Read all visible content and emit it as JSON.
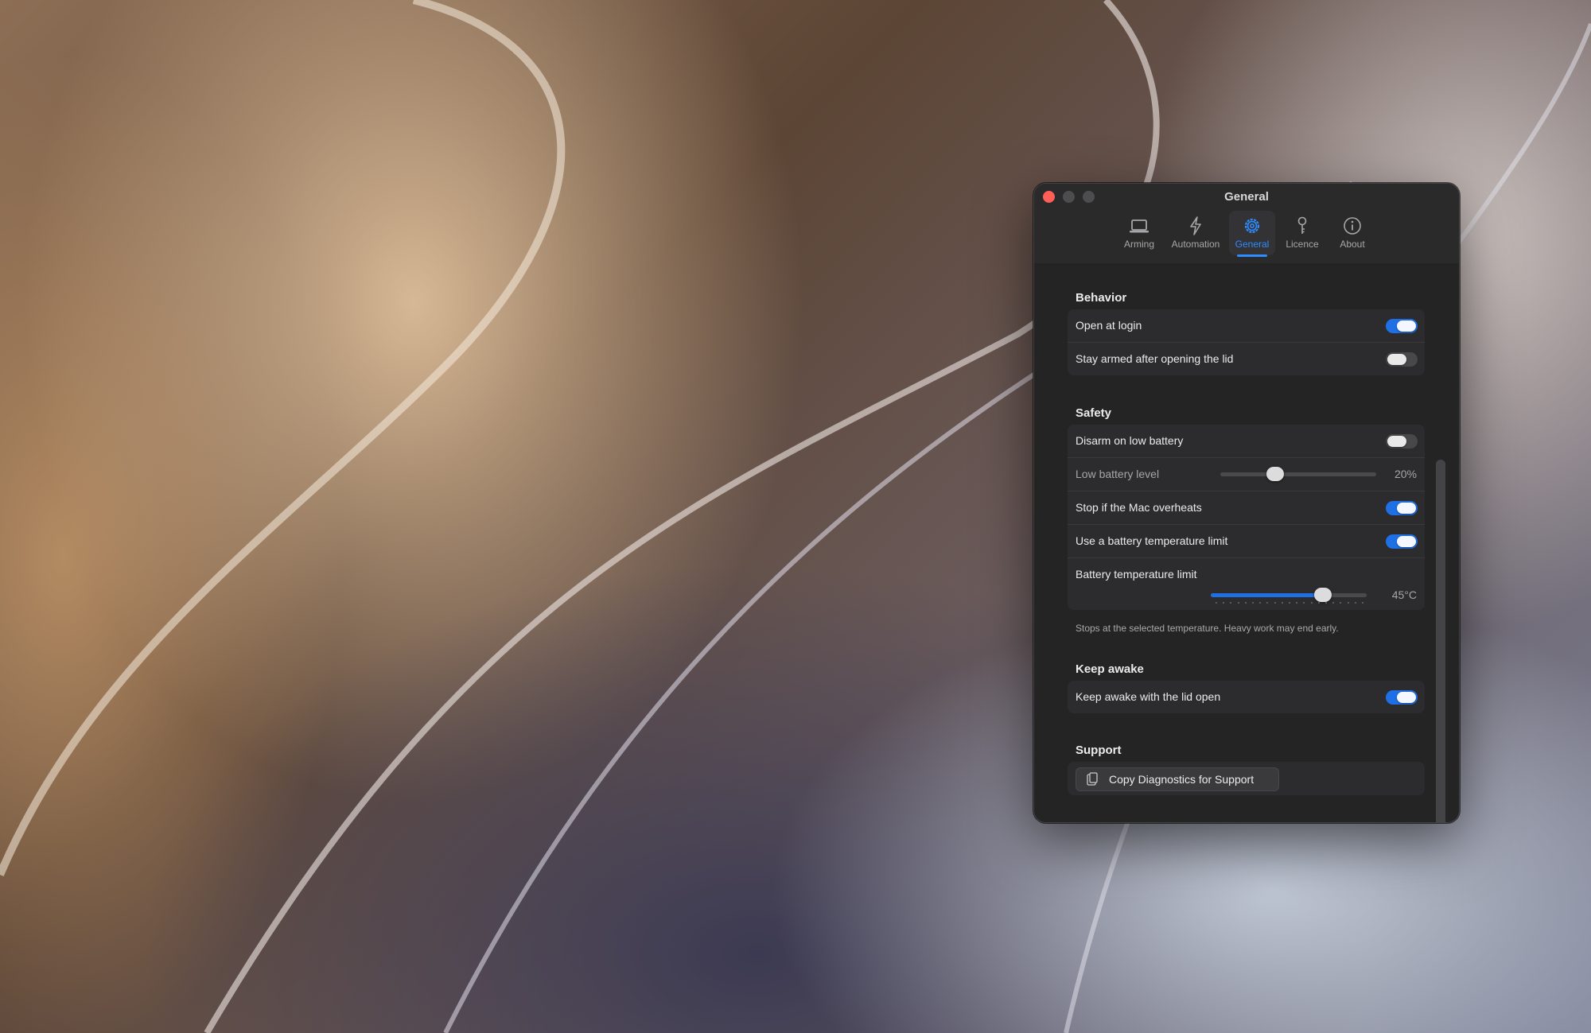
{
  "window": {
    "title": "General"
  },
  "tabs": [
    {
      "label": "Arming",
      "icon": "laptop-icon",
      "active": false
    },
    {
      "label": "Automation",
      "icon": "bolt-icon",
      "active": false
    },
    {
      "label": "General",
      "icon": "gear-icon",
      "active": true
    },
    {
      "label": "Licence",
      "icon": "key-icon",
      "active": false
    },
    {
      "label": "About",
      "icon": "info-icon",
      "active": false
    }
  ],
  "behavior": {
    "title": "Behavior",
    "open_at_login": {
      "label": "Open at login",
      "on": true
    },
    "stay_armed": {
      "label": "Stay armed after opening the lid",
      "on": false
    }
  },
  "safety": {
    "title": "Safety",
    "disarm_low_battery": {
      "label": "Disarm on low battery",
      "on": false
    },
    "low_battery_level": {
      "label": "Low battery level",
      "value_text": "20%",
      "fraction": 0.35
    },
    "stop_overheat": {
      "label": "Stop if the Mac overheats",
      "on": true
    },
    "battery_temp_limit_toggle": {
      "label": "Use a battery temperature limit",
      "on": true
    },
    "battery_temp_limit": {
      "label": "Battery temperature limit",
      "value_text": "45°C",
      "fraction": 0.72
    },
    "caption": "Stops at the selected temperature. Heavy work may end early."
  },
  "keep_awake": {
    "title": "Keep awake",
    "lid_open": {
      "label": "Keep awake with the lid open",
      "on": true
    }
  },
  "support": {
    "title": "Support",
    "copy_button": "Copy Diagnostics for Support"
  },
  "colors": {
    "accent": "#1f6fe5",
    "close_button": "#fe5f57",
    "window_bg": "#252526"
  }
}
